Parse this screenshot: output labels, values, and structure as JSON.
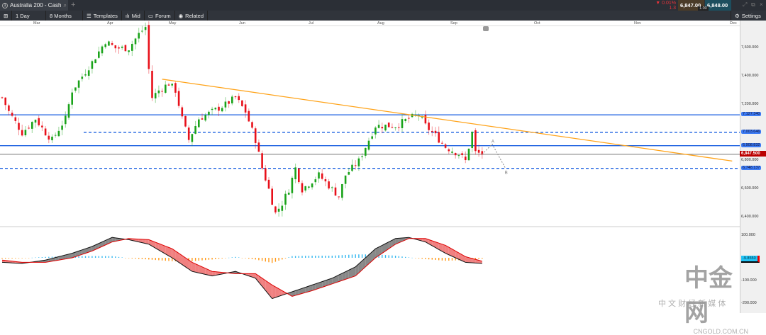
{
  "window": {
    "tab_title": "Australia 200 - Cash",
    "new_tab": "+"
  },
  "quote": {
    "change": "▼ 0.01%",
    "change_pts": "1.3",
    "sell": "6,847.00",
    "buy": "6,848.00",
    "spread": "1.00"
  },
  "toolbar": {
    "interval": "1 Day",
    "range": "8 Months",
    "templates": "Templates",
    "mid": "Mid",
    "forum": "Forum",
    "related": "Related",
    "settings": "Settings"
  },
  "colors": {
    "up": "#1aa31a",
    "down": "#e8101a",
    "trend": "#ffa319",
    "level": "#1a5fe0",
    "hist_pos": "#35b8f0",
    "hist_neg": "#ff9a1a"
  },
  "chart_data": {
    "type": "candlestick",
    "instrument": "Australia 200 - Cash",
    "months": [
      "Mar",
      "Apr",
      "May",
      "Jun",
      "Jul",
      "Aug",
      "Sep",
      "Oct",
      "Nov",
      "Dec"
    ],
    "price_ticks": [
      "7,600.000",
      "7,400.000",
      "7,200.000",
      "6,800.000",
      "6,600.000",
      "6,400.000"
    ],
    "ylim": [
      6350,
      7800
    ],
    "close_path": [
      [
        0,
        7250
      ],
      [
        2,
        7150
      ],
      [
        6,
        7000
      ],
      [
        10,
        7100
      ],
      [
        13,
        7000
      ],
      [
        15,
        6950
      ],
      [
        19,
        7100
      ],
      [
        21,
        7300
      ],
      [
        24,
        7400
      ],
      [
        27,
        7500
      ],
      [
        31,
        7650
      ],
      [
        34,
        7600
      ],
      [
        38,
        7600
      ],
      [
        41,
        7700
      ],
      [
        43,
        7750
      ],
      [
        44,
        7450
      ],
      [
        45,
        7250
      ],
      [
        47,
        7300
      ],
      [
        50,
        7350
      ],
      [
        52,
        7300
      ],
      [
        54,
        7100
      ],
      [
        56,
        6950
      ],
      [
        59,
        7100
      ],
      [
        63,
        7150
      ],
      [
        67,
        7200
      ],
      [
        70,
        7250
      ],
      [
        73,
        7150
      ],
      [
        76,
        6950
      ],
      [
        78,
        6750
      ],
      [
        80,
        6600
      ],
      [
        82,
        6430
      ],
      [
        84,
        6500
      ],
      [
        86,
        6600
      ],
      [
        88,
        6750
      ],
      [
        90,
        6600
      ],
      [
        95,
        6700
      ],
      [
        99,
        6600
      ],
      [
        101,
        6550
      ],
      [
        103,
        6700
      ],
      [
        107,
        6800
      ],
      [
        110,
        6950
      ],
      [
        112,
        7050
      ],
      [
        118,
        7050
      ],
      [
        122,
        7100
      ],
      [
        125,
        7130
      ],
      [
        127,
        7050
      ],
      [
        130,
        6980
      ],
      [
        133,
        6900
      ],
      [
        137,
        6850
      ],
      [
        139,
        6800
      ],
      [
        141,
        7000
      ],
      [
        142,
        6860
      ],
      [
        144,
        6850
      ]
    ],
    "levels": [
      {
        "label": "7,127.340",
        "value": 7127.34,
        "style": "solid"
      },
      {
        "label": "7,003.646",
        "value": 7003.646,
        "style": "dashed"
      },
      {
        "label": "6,908.832",
        "value": 6908.832,
        "style": "solid"
      },
      {
        "label": "6,748.137",
        "value": 6748.137,
        "style": "dashed"
      }
    ],
    "current": {
      "label": "6,847.500",
      "value": 6847.5
    },
    "trendline": [
      [
        48,
        7380
      ],
      [
        219,
        6800
      ]
    ],
    "projection": {
      "labels": [
        "A",
        "B"
      ],
      "points": [
        [
          144,
          6847
        ],
        [
          147,
          6920
        ],
        [
          151,
          6748
        ]
      ]
    },
    "oscillator": {
      "ticks": [
        "100.000",
        "-100.000",
        "-200.000"
      ],
      "value_label": "-9.8550",
      "ylim": [
        -200,
        100
      ],
      "fast": [
        [
          0,
          -20
        ],
        [
          6,
          -25
        ],
        [
          13,
          -10
        ],
        [
          21,
          20
        ],
        [
          27,
          50
        ],
        [
          33,
          90
        ],
        [
          38,
          80
        ],
        [
          44,
          60
        ],
        [
          51,
          0
        ],
        [
          57,
          -60
        ],
        [
          63,
          -80
        ],
        [
          70,
          -60
        ],
        [
          76,
          -90
        ],
        [
          81,
          -180
        ],
        [
          87,
          -150
        ],
        [
          93,
          -120
        ],
        [
          99,
          -90
        ],
        [
          106,
          -40
        ],
        [
          112,
          40
        ],
        [
          118,
          85
        ],
        [
          122,
          90
        ],
        [
          127,
          70
        ],
        [
          133,
          20
        ],
        [
          139,
          -20
        ],
        [
          144,
          -25
        ]
      ],
      "slow": [
        [
          0,
          -10
        ],
        [
          6,
          -20
        ],
        [
          13,
          -20
        ],
        [
          21,
          0
        ],
        [
          27,
          30
        ],
        [
          33,
          70
        ],
        [
          38,
          85
        ],
        [
          44,
          80
        ],
        [
          51,
          40
        ],
        [
          57,
          -20
        ],
        [
          63,
          -60
        ],
        [
          70,
          -70
        ],
        [
          76,
          -70
        ],
        [
          81,
          -120
        ],
        [
          87,
          -170
        ],
        [
          93,
          -145
        ],
        [
          99,
          -115
        ],
        [
          106,
          -80
        ],
        [
          112,
          0
        ],
        [
          118,
          60
        ],
        [
          122,
          85
        ],
        [
          127,
          85
        ],
        [
          133,
          55
        ],
        [
          139,
          5
        ],
        [
          144,
          -15
        ]
      ]
    }
  },
  "watermark": {
    "logo": "中金网",
    "domain": "CNGOLD.COM.CN",
    "tagline": "中 文 财 经 新 媒 体"
  }
}
